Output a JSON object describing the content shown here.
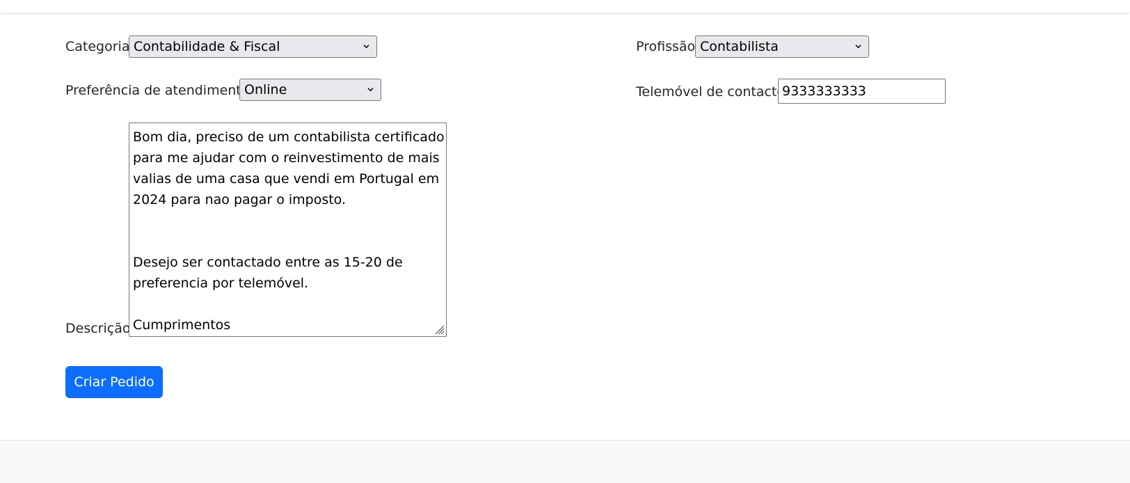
{
  "form": {
    "categoria": {
      "label": "Categoria",
      "selected": "Contabilidade & Fiscal"
    },
    "profissao": {
      "label": "Profissão",
      "selected": "Contabilista"
    },
    "preferencia": {
      "label": "Preferência de atendimento",
      "selected": "Online"
    },
    "telemovel": {
      "label": "Telemóvel de contacto",
      "value": "9333333333"
    },
    "descricao": {
      "label": "Descrição",
      "lines": [
        "Bom dia, preciso de um contabilista certificado",
        "para me ajudar com o reinvestimento de mais",
        "valias de uma casa que vendi em Portugal em",
        "2024 para nao pagar o imposto.",
        "",
        "",
        "Desejo ser contactado entre as 15-20 de",
        "preferencia por telemóvel.",
        "",
        "Cumprimentos"
      ]
    },
    "submit_label": "Criar Pedido"
  },
  "colors": {
    "primary": "#0d6efd",
    "footer_bg": "#f8f9fa"
  }
}
